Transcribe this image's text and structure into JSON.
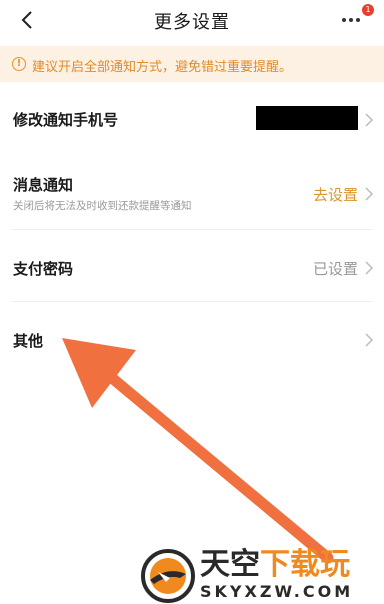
{
  "header": {
    "title": "更多设置",
    "badge_count": "1"
  },
  "banner": {
    "text": "建议开启全部通知方式，避免错过重要提醒。",
    "icon": "!"
  },
  "rows": [
    {
      "title": "修改通知手机号",
      "subtitle": "",
      "value": ""
    },
    {
      "title": "消息通知",
      "subtitle": "关闭后将无法及时收到还款提醒等通知",
      "value": "去设置"
    },
    {
      "title": "支付密码",
      "subtitle": "",
      "value": "已设置"
    },
    {
      "title": "其他",
      "subtitle": "",
      "value": ""
    }
  ],
  "watermark": {
    "title_dark": "天空",
    "title_orange": "下载玩",
    "subtitle": "SKYXZW.COM"
  },
  "colors": {
    "accent_orange": "#d9962f",
    "banner_bg": "#fdf1e3",
    "arrow": "#f07040",
    "badge": "#e8402f"
  }
}
